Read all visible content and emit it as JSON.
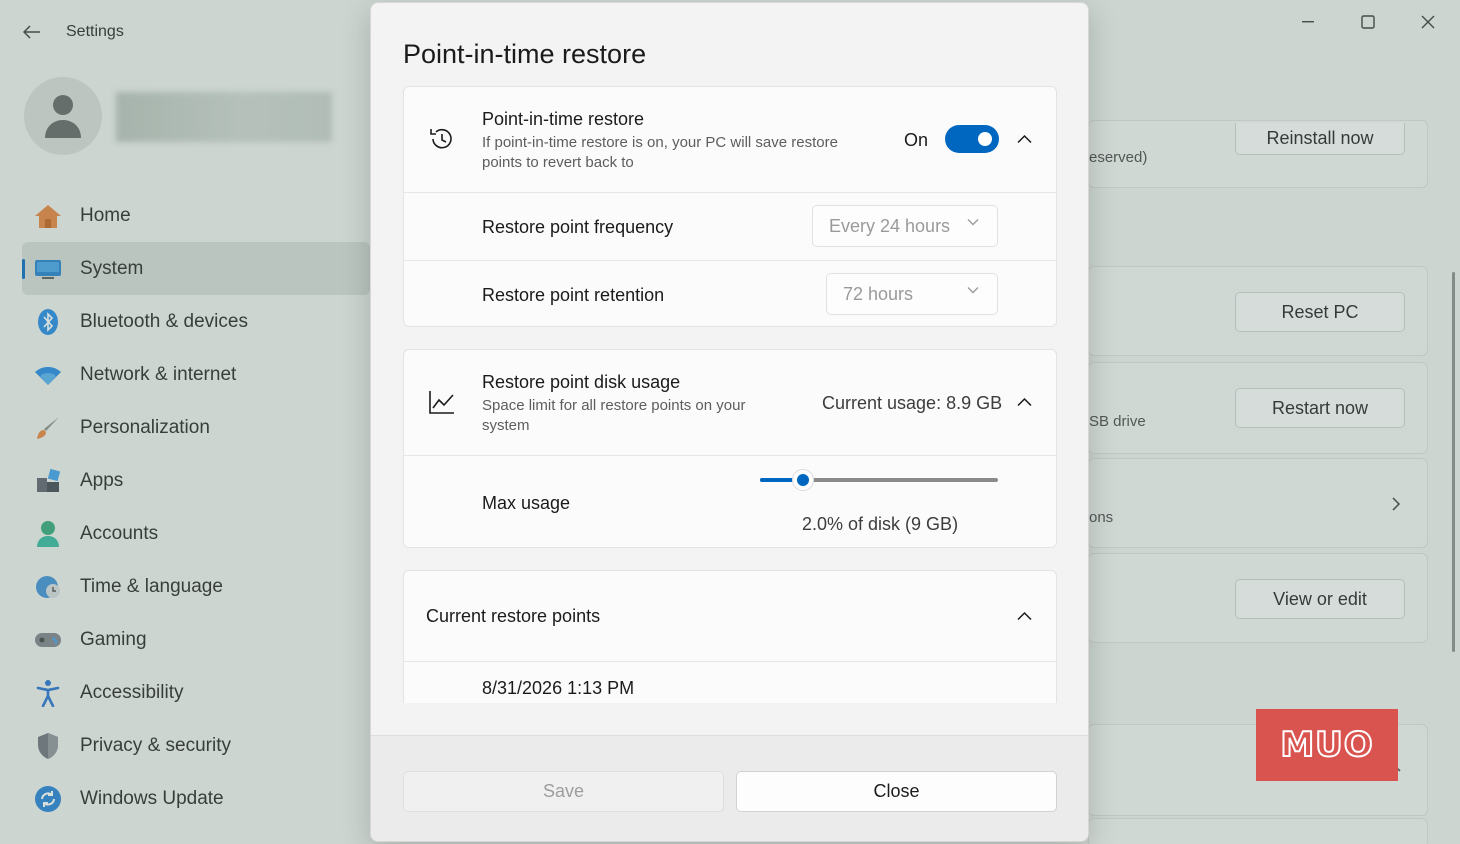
{
  "window": {
    "app_title": "Settings",
    "controls": [
      "minimize",
      "maximize",
      "close"
    ]
  },
  "sidebar": {
    "items": [
      {
        "label": "Home",
        "icon": "home-icon"
      },
      {
        "label": "System",
        "icon": "system-icon",
        "active": true
      },
      {
        "label": "Bluetooth & devices",
        "icon": "bluetooth-icon"
      },
      {
        "label": "Network & internet",
        "icon": "wifi-icon"
      },
      {
        "label": "Personalization",
        "icon": "brush-icon"
      },
      {
        "label": "Apps",
        "icon": "apps-icon"
      },
      {
        "label": "Accounts",
        "icon": "person-icon"
      },
      {
        "label": "Time & language",
        "icon": "globe-clock-icon"
      },
      {
        "label": "Gaming",
        "icon": "gamepad-icon"
      },
      {
        "label": "Accessibility",
        "icon": "accessibility-icon"
      },
      {
        "label": "Privacy & security",
        "icon": "shield-icon"
      },
      {
        "label": "Windows Update",
        "icon": "update-icon"
      }
    ]
  },
  "background_panel": {
    "reinstall_button": "Reinstall now",
    "reinstall_text": "eserved)",
    "reset_button": "Reset PC",
    "restart_button": "Restart now",
    "usb_text": "SB drive",
    "options_text": "ons",
    "view_edit_button": "View or edit"
  },
  "dialog": {
    "title": "Point-in-time restore",
    "restore_card": {
      "title": "Point-in-time restore",
      "description": "If point-in-time restore is on, your PC will save restore points to revert back to",
      "state_label": "On",
      "enabled": true
    },
    "frequency": {
      "label": "Restore point frequency",
      "value": "Every 24 hours"
    },
    "retention": {
      "label": "Restore point retention",
      "value": "72 hours"
    },
    "disk_usage": {
      "title": "Restore point disk usage",
      "description": "Space limit for all restore points on your system",
      "current_usage": "Current usage: 8.9 GB"
    },
    "max_usage": {
      "label": "Max usage",
      "value_text": "2.0% of disk (9 GB)",
      "slider_fraction": 0.18
    },
    "restore_points": {
      "title": "Current restore points",
      "items": [
        "8/31/2026 1:13 PM"
      ]
    },
    "buttons": {
      "save": "Save",
      "close": "Close"
    }
  },
  "watermark": "MUO",
  "colors": {
    "accent": "#0067c0",
    "watermark_bg": "#d9534f"
  }
}
